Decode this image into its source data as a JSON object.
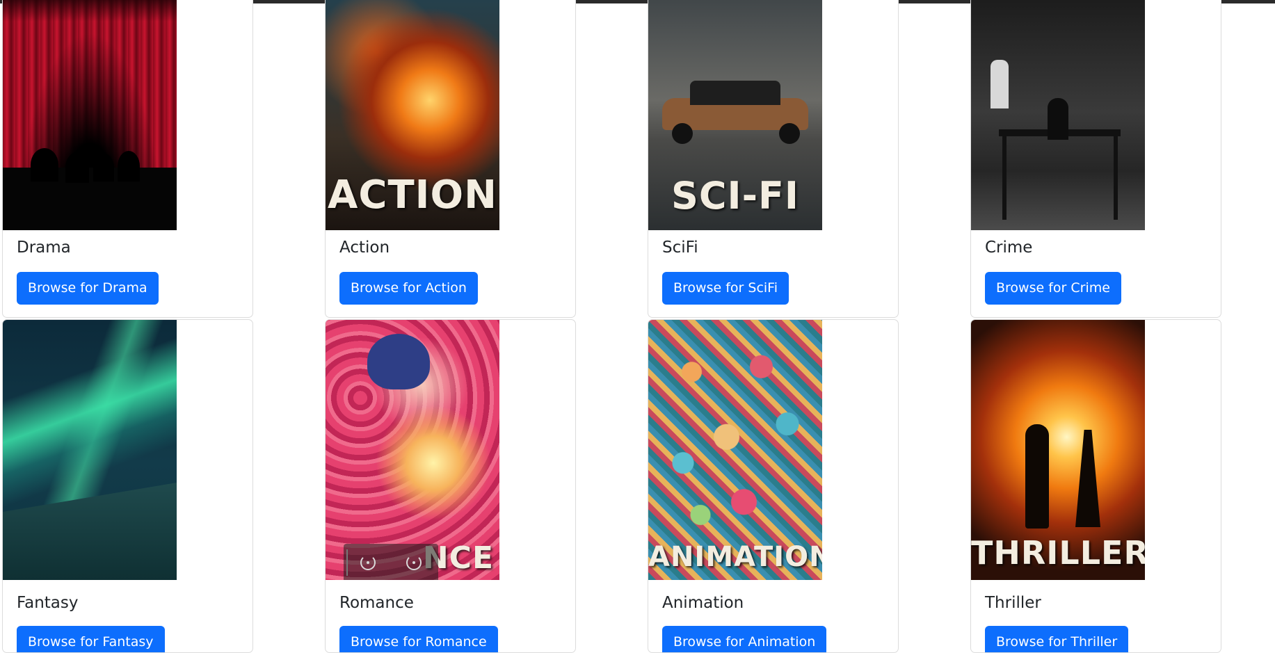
{
  "genres": [
    {
      "name": "Drama",
      "poster_text": "",
      "button": "Browse for Drama"
    },
    {
      "name": "Action",
      "poster_text": "ACTION",
      "button": "Browse for Action"
    },
    {
      "name": "SciFi",
      "poster_text": "SCI-FI",
      "button": "Browse for SciFi"
    },
    {
      "name": "Crime",
      "poster_text": "",
      "button": "Browse for Crime"
    },
    {
      "name": "Fantasy",
      "poster_text": "",
      "button": "Browse for Fantasy"
    },
    {
      "name": "Romance",
      "poster_text": "NCE",
      "button": "Browse for Romance"
    },
    {
      "name": "Animation",
      "poster_text": "ANIMATION",
      "button": "Browse for Animation"
    },
    {
      "name": "Thriller",
      "poster_text": "THRILLER",
      "button": "Browse for Thriller"
    }
  ],
  "icons": {
    "rewind": "rewind-icon",
    "forward": "forward-icon"
  },
  "colors": {
    "button": "#0d6efd",
    "card_border": "#dcdcdc"
  }
}
